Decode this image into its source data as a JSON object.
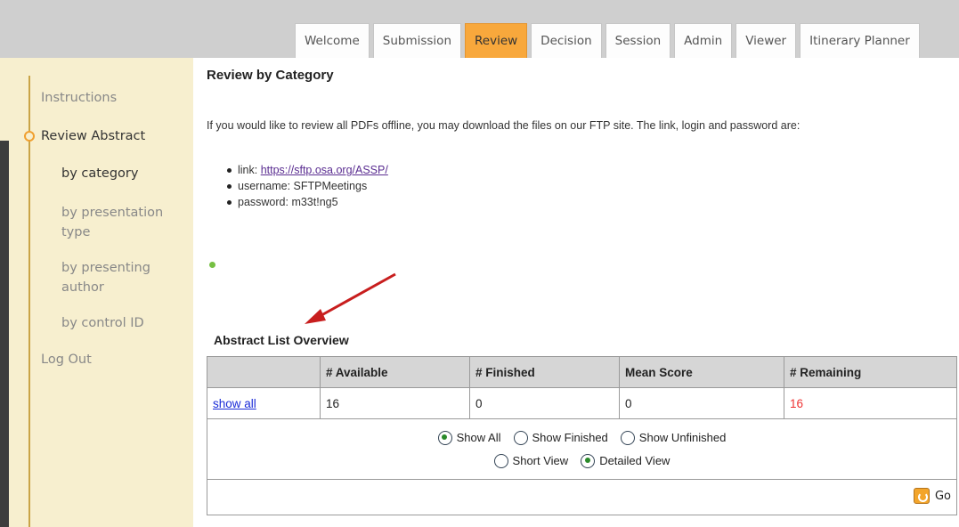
{
  "tabs": [
    {
      "label": "Welcome",
      "active": false
    },
    {
      "label": "Submission",
      "active": false
    },
    {
      "label": "Review",
      "active": true
    },
    {
      "label": "Decision",
      "active": false
    },
    {
      "label": "Session",
      "active": false
    },
    {
      "label": "Admin",
      "active": false
    },
    {
      "label": "Viewer",
      "active": false
    },
    {
      "label": "Itinerary Planner",
      "active": false
    }
  ],
  "sidebar": {
    "instructions": "Instructions",
    "review_abstract": "Review Abstract",
    "by_category": "by category",
    "by_presentation_type": "by presentation type",
    "by_presenting_author": "by presenting author",
    "by_control_id": "by control ID",
    "log_out": "Log Out"
  },
  "main": {
    "title": "Review by Category",
    "intro": "If you would like to review all PDFs offline, you may download the files on our FTP site. The link, login and password are:",
    "link_prefix": "link: ",
    "link_url": "https://sftp.osa.org/ASSP/",
    "username": "username: SFTPMeetings",
    "password": "password: m33t!ng5"
  },
  "overview": {
    "title": "Abstract List Overview",
    "headers": [
      "",
      "# Available",
      "# Finished",
      "Mean Score",
      "# Remaining"
    ],
    "row": {
      "link": "show all",
      "available": "16",
      "finished": "0",
      "mean_score": "0",
      "remaining": "16"
    },
    "options": {
      "show_all": "Show All",
      "show_finished": "Show Finished",
      "show_unfinished": "Show Unfinished",
      "short_view": "Short View",
      "detailed_view": "Detailed View"
    },
    "go_label": "Go"
  },
  "colors": {
    "accent_tab": "#f8a83c",
    "sidebar_bg": "#f7efcf",
    "remaining_red": "#e33333",
    "arrow_red": "#c81e1e"
  }
}
